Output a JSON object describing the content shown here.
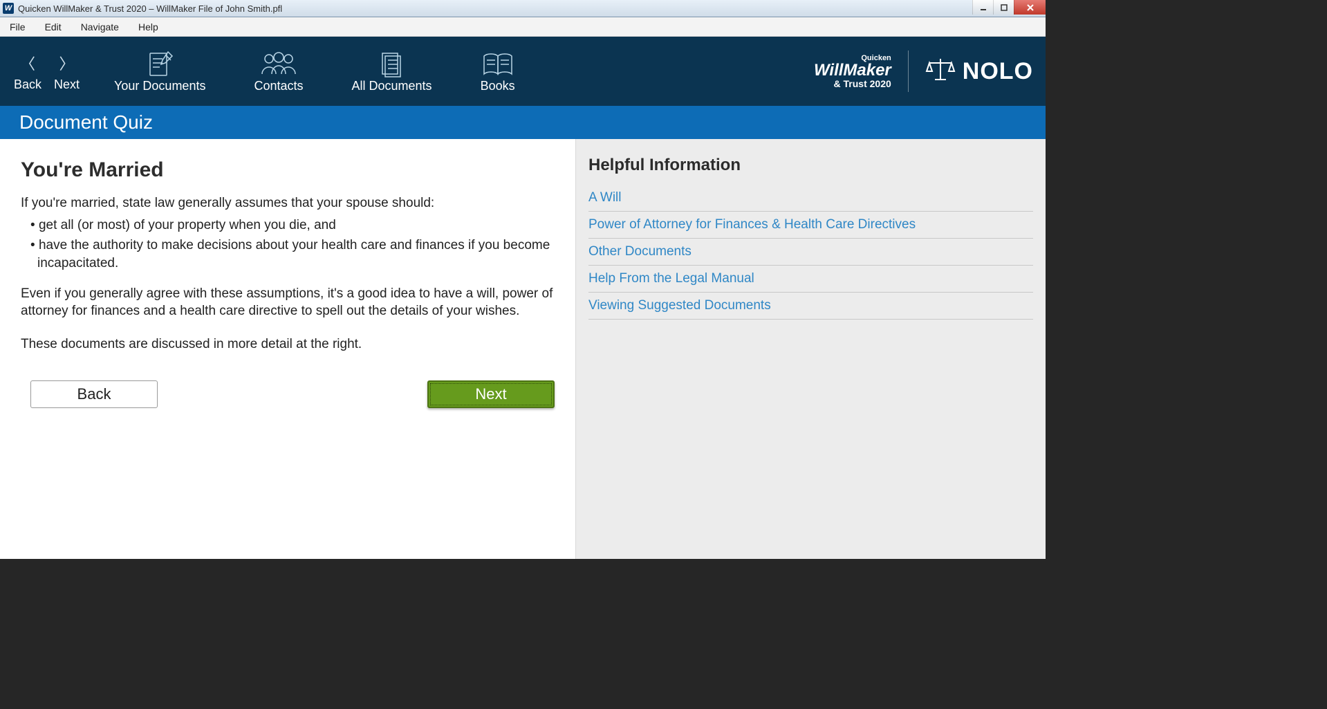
{
  "titlebar": {
    "icon_letter": "W",
    "text": "Quicken WillMaker & Trust 2020 – WillMaker File of John Smith.pfl"
  },
  "menubar": [
    "File",
    "Edit",
    "Navigate",
    "Help"
  ],
  "toolbar": {
    "back": "Back",
    "next": "Next",
    "your_documents": "Your Documents",
    "contacts": "Contacts",
    "all_documents": "All Documents",
    "books": "Books"
  },
  "brand": {
    "quicken": "Quicken",
    "willmaker": "WillMaker",
    "trust": "& Trust 2020",
    "nolo": "NOLO"
  },
  "subheader": "Document Quiz",
  "main": {
    "heading": "You're Married",
    "intro": "If you're married, state law generally assumes that your spouse should:",
    "bullets": [
      "get all (or most) of your property when you die, and",
      "have the authority to make decisions about your health care and finances if you become incapacitated."
    ],
    "para2": "Even if you generally agree with these assumptions, it's a good idea to have a will, power of attorney for finances and a health care directive to spell out the details of your wishes.",
    "para3": "These documents are discussed in more detail at the right.",
    "back_btn": "Back",
    "next_btn": "Next"
  },
  "sidebar": {
    "heading": "Helpful Information",
    "links": [
      "A Will",
      "Power of Attorney for Finances & Health Care Directives",
      "Other Documents",
      "Help From the Legal Manual",
      "Viewing Suggested Documents"
    ]
  }
}
